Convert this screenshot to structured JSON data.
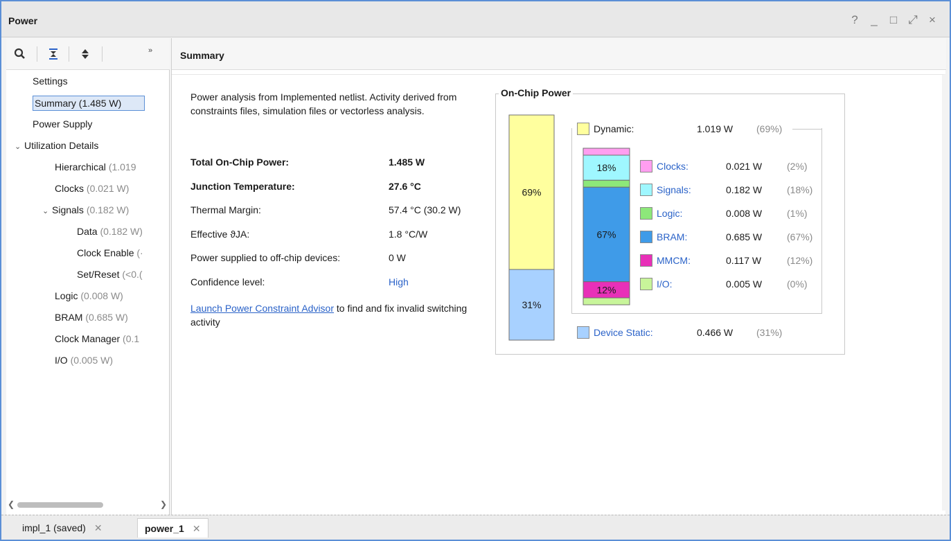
{
  "window": {
    "title": "Power",
    "controls": [
      "?",
      "_",
      "□",
      "⤢",
      "×"
    ]
  },
  "toolbar": {
    "icons": [
      "search-icon",
      "collapse-all-icon",
      "expand-all-icon",
      "more-icon"
    ],
    "more_label": "»"
  },
  "tree": {
    "items": [
      {
        "label": "Settings",
        "value": ""
      },
      {
        "label": "Summary (1.485 W)",
        "value": ""
      },
      {
        "label": "Power Supply",
        "value": ""
      },
      {
        "label": "Utilization Details",
        "value": ""
      },
      {
        "label": "Hierarchical",
        "value": "(1.019"
      },
      {
        "label": "Clocks",
        "value": "(0.021 W)"
      },
      {
        "label": "Signals",
        "value": "(0.182 W)"
      },
      {
        "label": "Data",
        "value": "(0.182 W)"
      },
      {
        "label": "Clock Enable",
        "value": "(·"
      },
      {
        "label": "Set/Reset",
        "value": "(<0.("
      },
      {
        "label": "Logic",
        "value": "(0.008 W)"
      },
      {
        "label": "BRAM",
        "value": "(0.685 W)"
      },
      {
        "label": "Clock Manager",
        "value": "(0.1"
      },
      {
        "label": "I/O",
        "value": "(0.005 W)"
      }
    ]
  },
  "summary": {
    "header": "Summary",
    "intro": "Power analysis from Implemented netlist. Activity derived from constraints files, simulation files or vectorless analysis.",
    "rows": [
      {
        "label": "Total On-Chip Power:",
        "value": "1.485 W"
      },
      {
        "label": "Junction Temperature:",
        "value": "27.6 °C"
      },
      {
        "label": "Thermal Margin:",
        "value": "57.4 °C (30.2 W)"
      },
      {
        "label": "Effective ϑJA:",
        "value": "1.8 °C/W"
      },
      {
        "label": "Power supplied to off-chip devices:",
        "value": "0 W"
      },
      {
        "label": "Confidence level:",
        "value": "High"
      }
    ],
    "advisor_link": "Launch Power Constraint Advisor",
    "advisor_text": " to find and fix invalid switching activity"
  },
  "chart_data": {
    "type": "bar",
    "title": "On-Chip Power",
    "total": {
      "segments": [
        {
          "name": "Dynamic",
          "value": 1.019,
          "label": "69%",
          "color": "#ffff9e"
        },
        {
          "name": "Device Static",
          "value": 0.466,
          "label": "31%",
          "color": "#a8d1ff"
        }
      ]
    },
    "dynamic": {
      "segments": [
        {
          "name": "Clocks",
          "value": 0.021,
          "pct": 2,
          "color": "#ff9ef0"
        },
        {
          "name": "Signals",
          "value": 0.182,
          "pct": 18,
          "label": "18%",
          "color": "#9ff7ff"
        },
        {
          "name": "Logic",
          "value": 0.008,
          "pct": 1,
          "color": "#8de87a"
        },
        {
          "name": "BRAM",
          "value": 0.685,
          "pct": 67,
          "label": "67%",
          "color": "#3f9be8"
        },
        {
          "name": "MMCM",
          "value": 0.117,
          "pct": 12,
          "label": "12%",
          "color": "#e830b8"
        },
        {
          "name": "I/O",
          "value": 0.005,
          "pct": 0,
          "color": "#c8f59a"
        }
      ]
    },
    "legend": {
      "dynamic": {
        "name": "Dynamic:",
        "value": "1.019 W",
        "pct": "(69%)"
      },
      "items": [
        {
          "name": "Clocks:",
          "value": "0.021 W",
          "pct": "(2%)"
        },
        {
          "name": "Signals:",
          "value": "0.182 W",
          "pct": "(18%)"
        },
        {
          "name": "Logic:",
          "value": "0.008 W",
          "pct": "(1%)"
        },
        {
          "name": "BRAM:",
          "value": "0.685 W",
          "pct": "(67%)"
        },
        {
          "name": "MMCM:",
          "value": "0.117 W",
          "pct": "(12%)"
        },
        {
          "name": "I/O:",
          "value": "0.005 W",
          "pct": "(0%)"
        }
      ],
      "static": {
        "name": "Device Static:",
        "value": "0.466 W",
        "pct": "(31%)"
      }
    }
  },
  "tabs": [
    {
      "label": "impl_1 (saved)",
      "active": false
    },
    {
      "label": "power_1",
      "active": true
    }
  ]
}
